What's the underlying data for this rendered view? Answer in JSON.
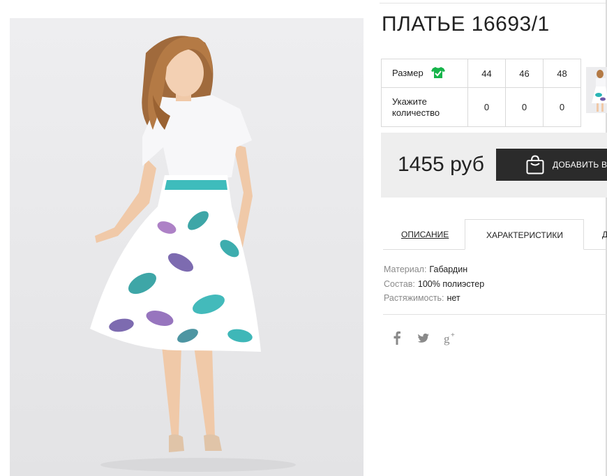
{
  "product": {
    "title": "ПЛАТЬЕ 16693/1",
    "price": "1455 руб",
    "add_to_cart": "ДОБАВИТЬ В"
  },
  "size_table": {
    "size_label": "Размер",
    "qty_label_line1": "Укажите",
    "qty_label_line2": "количество",
    "sizes": [
      "44",
      "46",
      "48"
    ],
    "quantities": [
      "0",
      "0",
      "0"
    ]
  },
  "tabs": [
    {
      "label": "Описание",
      "active": false
    },
    {
      "label": "Характеристики",
      "active": true
    },
    {
      "label": "Д",
      "active": false
    }
  ],
  "specs": [
    {
      "key": "Материал:",
      "value": "Габардин"
    },
    {
      "key": "Состав:",
      "value": "100% полиэстер"
    },
    {
      "key": "Растяжимость:",
      "value": "нет"
    }
  ],
  "social": [
    "facebook-icon",
    "twitter-icon",
    "google-plus-icon"
  ],
  "colors": {
    "accent_green": "#16b44a",
    "button_dark": "#2b2b2b",
    "price_bg": "#eeeeee"
  }
}
